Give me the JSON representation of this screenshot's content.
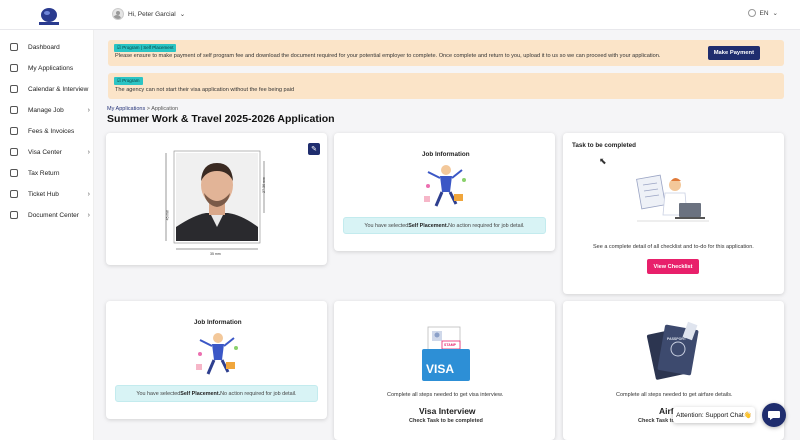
{
  "header": {
    "greeting": "Hi, Peter Garcial",
    "greeting_chevron": "⌄",
    "language": "EN",
    "language_chevron": "⌄"
  },
  "sidebar": {
    "items": [
      {
        "label": "Dashboard",
        "chevron": ""
      },
      {
        "label": "My Applications",
        "chevron": ""
      },
      {
        "label": "Calendar & Interview",
        "chevron": ""
      },
      {
        "label": "Manage Job",
        "chevron": "›"
      },
      {
        "label": "Fees & Invoices",
        "chevron": ""
      },
      {
        "label": "Visa Center",
        "chevron": "›"
      },
      {
        "label": "Tax Return",
        "chevron": ""
      },
      {
        "label": "Ticket Hub",
        "chevron": "›"
      },
      {
        "label": "Document Center",
        "chevron": "›"
      }
    ]
  },
  "alerts": {
    "payment": {
      "tag": "☑ Program | Self Placement",
      "message": "Please ensure to make payment of self program fee and download the document required for your potential employer to complete. Once complete and return to you, upload it to us so we can proceed with your application.",
      "button": "Make Payment"
    },
    "visa": {
      "tag": "☑ Program",
      "message": "The agency can not start their visa application without the fee being paid"
    }
  },
  "breadcrumb": {
    "link": "My Applications",
    "separator": ">",
    "current": "Application"
  },
  "page_title": "Summer Work & Travel 2025-2026 Application",
  "photo_card": {
    "dim_height": "45 mm",
    "dim_width": "35 mm",
    "dim_face": "27-36 mm"
  },
  "job_info": {
    "title": "Job Information",
    "prefix": "You have selected ",
    "bold": "Self Placement.",
    "suffix": " No action required for job detail."
  },
  "task_card": {
    "title": "Task to be completed",
    "description": "See a complete detail of all checklist and to-do for this application.",
    "button": "View Checklist"
  },
  "visa_card": {
    "badge": "VISA",
    "stamp": "STAMP",
    "description": "Complete all steps needed to get visa interview.",
    "title": "Visa Interview",
    "link": "Check Task to be completed"
  },
  "airfare_card": {
    "passport_label": "PASSPORT",
    "description": "Complete all steps needed to get airfare details.",
    "title": "Airfare",
    "link": "Check Task to be completed"
  },
  "support_chat": {
    "label": "Attention: Support Chat👋"
  },
  "colors": {
    "primary": "#1f2d6e",
    "accent_pink": "#e8206b",
    "alert_bg": "#fbe4c8",
    "info_bg": "#d8f3f5",
    "tag_teal": "#2bc4c4"
  }
}
